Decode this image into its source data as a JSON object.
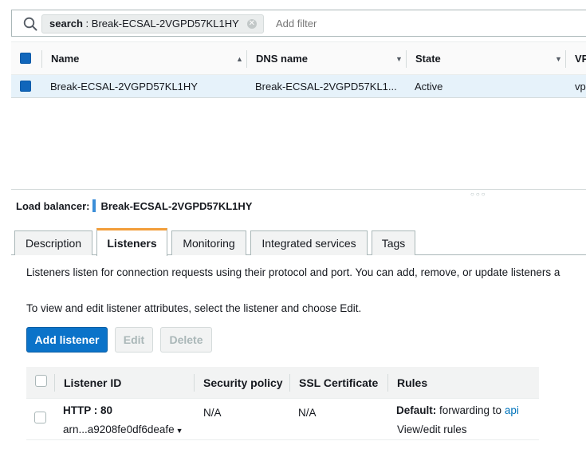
{
  "filter": {
    "token_key": "search",
    "token_value": "Break-ECSAL-2VGPD57KL1HY",
    "add_filter_placeholder": "Add filter"
  },
  "lb_table": {
    "columns": [
      "Name",
      "DNS name",
      "State",
      "VP"
    ],
    "rows": [
      {
        "name": "Break-ECSAL-2VGPD57KL1HY",
        "dns_name": "Break-ECSAL-2VGPD57KL1...",
        "state": "Active",
        "vpc": "vpc"
      }
    ]
  },
  "details": {
    "label": "Load balancer:",
    "name": "Break-ECSAL-2VGPD57KL1HY"
  },
  "tabs": [
    {
      "label": "Description",
      "active": false
    },
    {
      "label": "Listeners",
      "active": true
    },
    {
      "label": "Monitoring",
      "active": false
    },
    {
      "label": "Integrated services",
      "active": false
    },
    {
      "label": "Tags",
      "active": false
    }
  ],
  "listeners": {
    "intro": "Listeners listen for connection requests using their protocol and port. You can add, remove, or update listeners a",
    "hint": "To view and edit listener attributes, select the listener and choose Edit.",
    "buttons": {
      "add": "Add listener",
      "edit": "Edit",
      "delete": "Delete"
    },
    "columns": [
      "Listener ID",
      "Security policy",
      "SSL Certificate",
      "Rules"
    ],
    "rows": [
      {
        "listener_id": "HTTP : 80",
        "arn": "arn...a9208fe0df6deafe",
        "security_policy": "N/A",
        "ssl_certificate": "N/A",
        "rule_label": "Default:",
        "rule_action": "forwarding to",
        "rule_target": "api",
        "view_rules_link": "View/edit rules"
      }
    ]
  },
  "colors": {
    "primary_button": "#0b73c9",
    "active_tab_accent": "#f29d39",
    "selected_row": "#e6f2fa",
    "link": "#0073bb"
  }
}
